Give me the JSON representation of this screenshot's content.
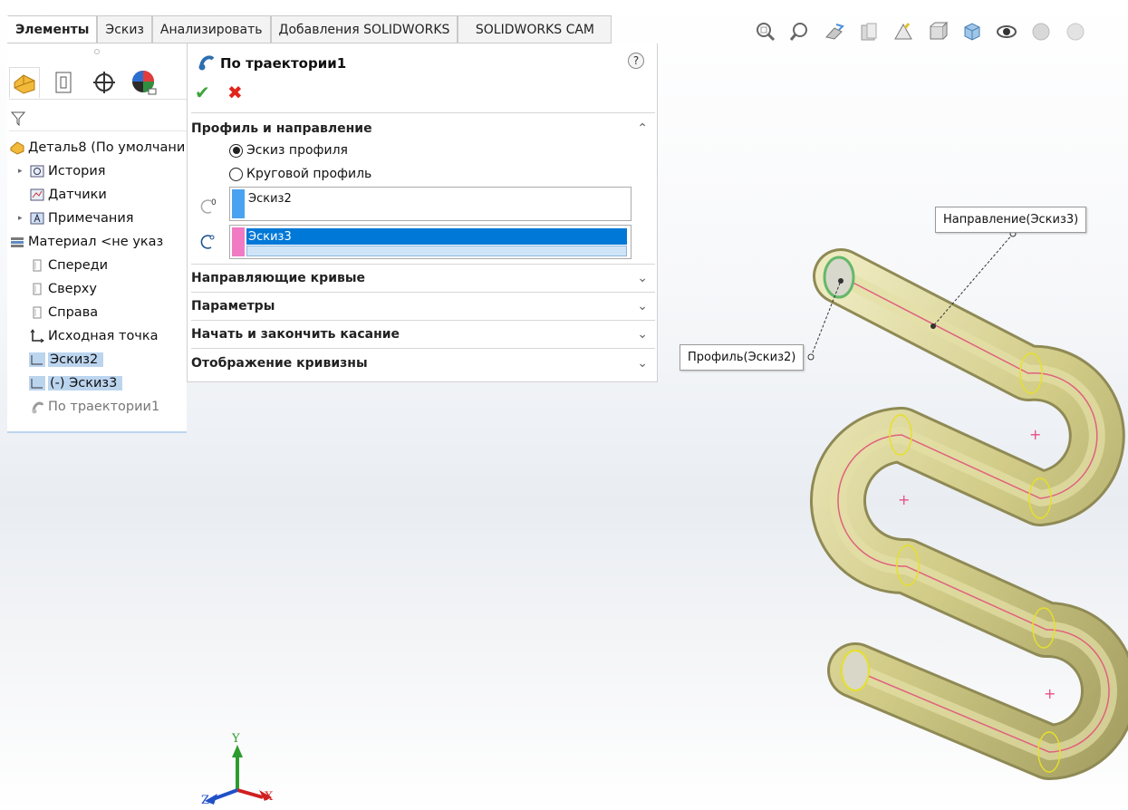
{
  "tabs": [
    {
      "label": "Элементы",
      "active": true
    },
    {
      "label": "Эскиз"
    },
    {
      "label": "Анализировать"
    },
    {
      "label": "Добавления SOLIDWORKS"
    },
    {
      "label": "SOLIDWORKS CAM"
    }
  ],
  "toolbar": {
    "icons": [
      "zoom-to-fit-icon",
      "zoom-area-icon",
      "previous-view-icon",
      "section-view-icon",
      "dynamic-annotation-icon",
      "view-orientation-icon",
      "display-style-icon",
      "hide-show-icon",
      "appearance-icon",
      "scene-icon"
    ]
  },
  "tree": {
    "root": "Деталь8  (По умолчани",
    "items": [
      {
        "label": "История",
        "icon": "history-icon",
        "arrow": true
      },
      {
        "label": "Датчики",
        "icon": "sensors-icon"
      },
      {
        "label": "Примечания",
        "icon": "annotations-icon",
        "arrow": true
      },
      {
        "label": "Материал <не указ",
        "icon": "material-icon"
      },
      {
        "label": "Спереди",
        "icon": "plane-icon"
      },
      {
        "label": "Сверху",
        "icon": "plane-icon"
      },
      {
        "label": "Справа",
        "icon": "plane-icon"
      },
      {
        "label": "Исходная точка",
        "icon": "origin-icon"
      },
      {
        "label": "Эскиз2",
        "icon": "sketch-icon",
        "selected": true
      },
      {
        "label": "(-) Эскиз3",
        "icon": "sketch-icon",
        "selected": true
      },
      {
        "label": "По траектории1",
        "icon": "sweep-icon",
        "dim": true
      }
    ]
  },
  "property_manager": {
    "title": "По траектории1",
    "help": "?",
    "ok": "✔",
    "cancel": "✖",
    "sections": {
      "profile_direction": "Профиль и направление",
      "guide_curves": "Направляющие кривые",
      "options": "Параметры",
      "tangency": "Начать и закончить касание",
      "curvature": "Отображение кривизны"
    },
    "radio_sketch_profile": "Эскиз профиля",
    "radio_circular_profile": "Круговой профиль",
    "profile_value": "Эскиз2",
    "path_value": "Эскиз3",
    "chevron_up": "⌃",
    "chevron_down": "⌄"
  },
  "callouts": {
    "direction": "Направление(Эскиз3)",
    "profile": "Профиль(Эскиз2)"
  },
  "triad": {
    "x": "X",
    "y": "Y",
    "z": "Z"
  },
  "colors": {
    "profile_swatch": "#4aa3f0",
    "path_swatch": "#f07ac4",
    "selection": "#0078d7",
    "tube": "#d6d18e",
    "ok": "#3aa53a",
    "cancel": "#e2231a"
  }
}
